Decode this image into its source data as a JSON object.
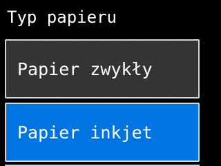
{
  "header": {
    "title": "Typ papieru"
  },
  "options": [
    {
      "label": "Papier zwykły",
      "selected": false
    },
    {
      "label": "Papier inkjet",
      "selected": true
    }
  ],
  "colors": {
    "background": "#000000",
    "option_default": "#333333",
    "option_selected": "#0074e0",
    "border": "#d4d4d4",
    "text": "#ffffff"
  }
}
